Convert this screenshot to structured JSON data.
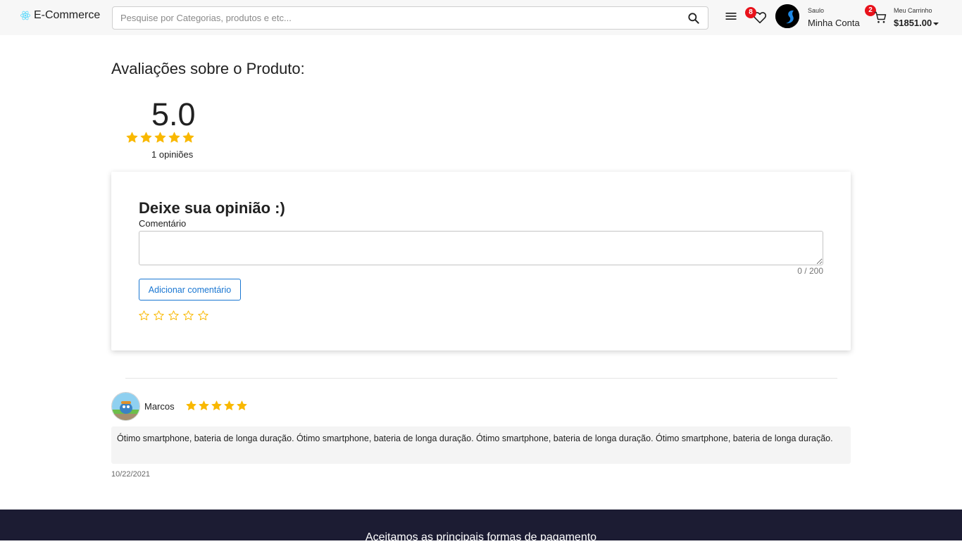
{
  "header": {
    "logo_text": "E-Commerce",
    "search_placeholder": "Pesquise por Categorias, produtos e etc...",
    "favorites_count": "8",
    "account": {
      "greeting": "Saulo",
      "label": "Minha Conta"
    },
    "cart": {
      "count": "2",
      "label": "Meu Carrinho",
      "total": "$1851.00"
    }
  },
  "reviews": {
    "title": "Avaliações sobre o Produto:",
    "average": "5.0",
    "average_stars": 5,
    "count_text": "1 opiniões"
  },
  "form": {
    "title": "Deixe sua opinião :)",
    "field_label": "Comentário",
    "comment_value": "",
    "counter": "0 / 200",
    "submit_label": "Adicionar comentário",
    "rating_value": 0
  },
  "review_list": [
    {
      "name": "Marcos",
      "stars": 5,
      "text": "Ótimo smartphone, bateria de longa duração. Ótimo smartphone, bateria de longa duração. Ótimo smartphone, bateria de longa duração. Ótimo smartphone, bateria de longa duração.",
      "date": "10/22/2021"
    }
  ],
  "footer": {
    "title": "Aceitamos as principais formas de pagamento"
  },
  "colors": {
    "star": "#f9b800",
    "accent": "#1976d2",
    "badge": "#e8121b",
    "footer": "#1c1c33"
  }
}
